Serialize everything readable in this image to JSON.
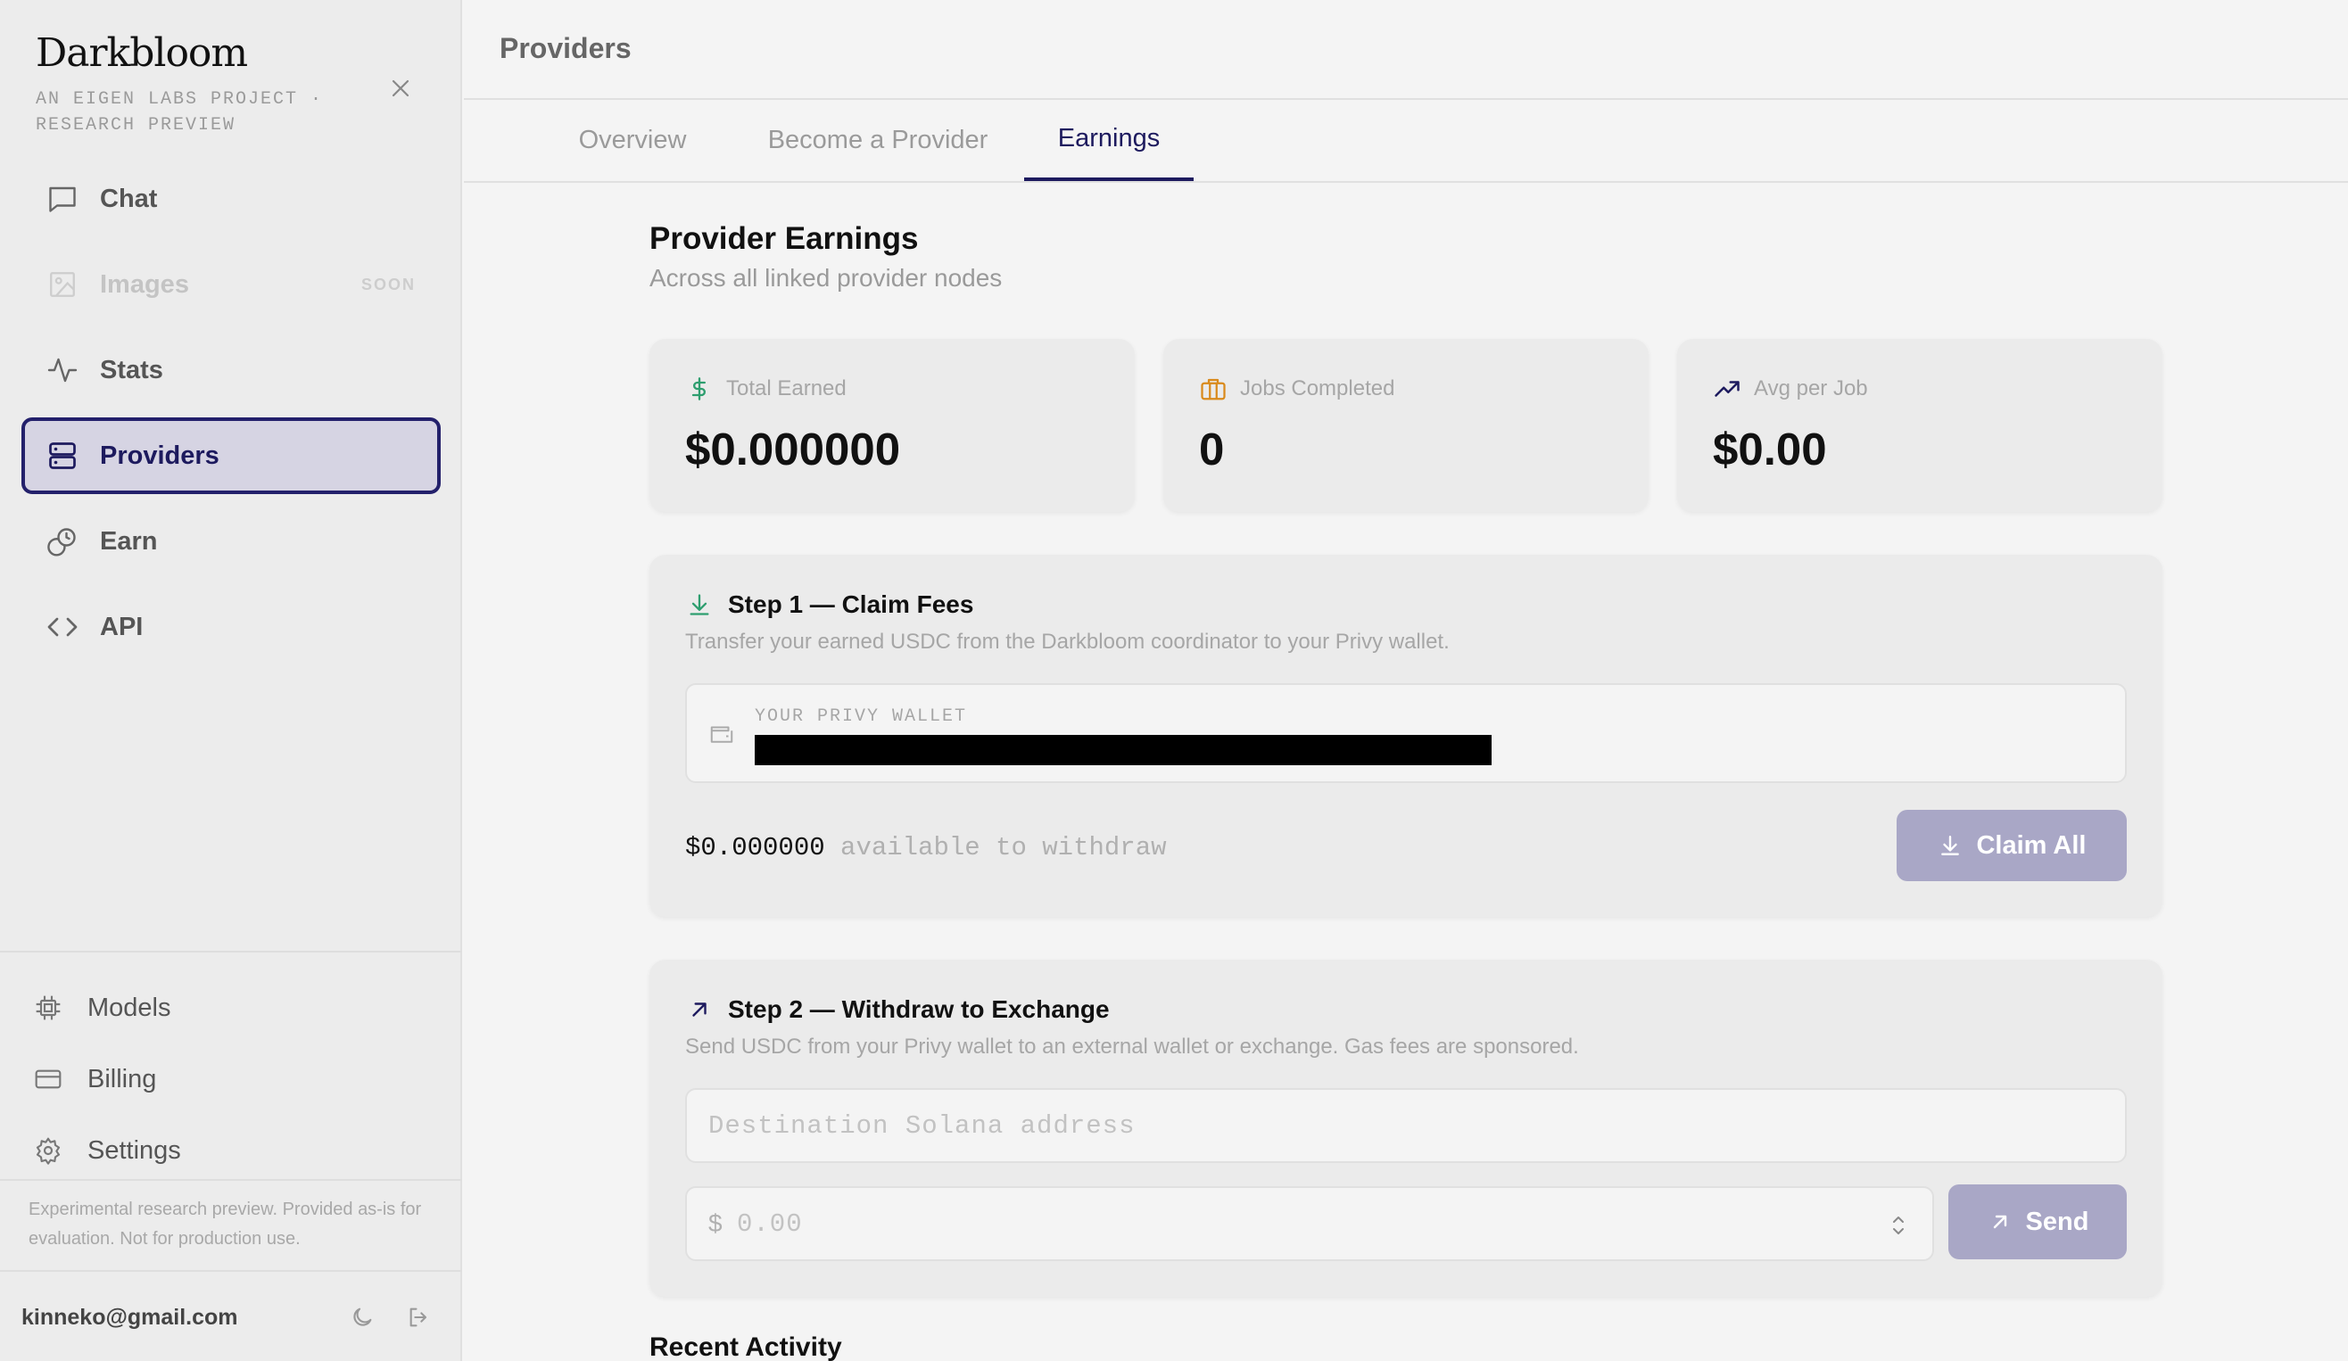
{
  "app": {
    "brand": "Darkbloom",
    "brand_subtitle": "AN EIGEN LABS PROJECT · RESEARCH PREVIEW"
  },
  "sidebar": {
    "items": [
      {
        "label": "Chat",
        "icon": "chat-icon"
      },
      {
        "label": "Images",
        "icon": "image-icon",
        "badge": "SOON",
        "disabled": true
      },
      {
        "label": "Stats",
        "icon": "activity-icon"
      },
      {
        "label": "Providers",
        "icon": "server-icon",
        "active": true
      },
      {
        "label": "Earn",
        "icon": "coins-icon"
      },
      {
        "label": "API",
        "icon": "code-icon"
      }
    ],
    "secondary": [
      {
        "label": "Models",
        "icon": "chip-icon"
      },
      {
        "label": "Billing",
        "icon": "credit-card-icon"
      },
      {
        "label": "Settings",
        "icon": "gear-icon"
      }
    ],
    "disclaimer": "Experimental research preview. Provided as-is for evaluation. Not for production use.",
    "user_email": "kinneko@gmail.com"
  },
  "header": {
    "title": "Providers"
  },
  "tabs": [
    {
      "label": "Overview"
    },
    {
      "label": "Become a Provider"
    },
    {
      "label": "Earnings",
      "active": true
    }
  ],
  "earnings": {
    "title": "Provider Earnings",
    "subtitle": "Across all linked provider nodes",
    "stats": [
      {
        "label": "Total Earned",
        "value": "$0.000000",
        "icon": "dollar-icon",
        "color": "#2e9e6f"
      },
      {
        "label": "Jobs Completed",
        "value": "0",
        "icon": "briefcase-icon",
        "color": "#d98a1c"
      },
      {
        "label": "Avg per Job",
        "value": "$0.00",
        "icon": "trending-up-icon",
        "color": "#1d1a5e"
      }
    ]
  },
  "step1": {
    "title": "Step 1 — Claim Fees",
    "description": "Transfer your earned USDC from the Darkbloom coordinator to your Privy wallet.",
    "wallet_label": "YOUR PRIVY WALLET",
    "available_amount": "$0.000000",
    "available_text": "available to withdraw",
    "claim_button": "Claim All"
  },
  "step2": {
    "title": "Step 2 — Withdraw to Exchange",
    "description": "Send USDC from your Privy wallet to an external wallet or exchange. Gas fees are sponsored.",
    "destination_placeholder": "Destination Solana address",
    "amount_prefix": "$",
    "amount_placeholder": "0.00",
    "send_button": "Send"
  },
  "recent_activity": {
    "title": "Recent Activity"
  },
  "colors": {
    "accent": "#1d1a5e",
    "active_bg": "#d6d4e3",
    "button_disabled": "#a9a7c6",
    "green": "#2e9e6f",
    "orange": "#d98a1c"
  }
}
